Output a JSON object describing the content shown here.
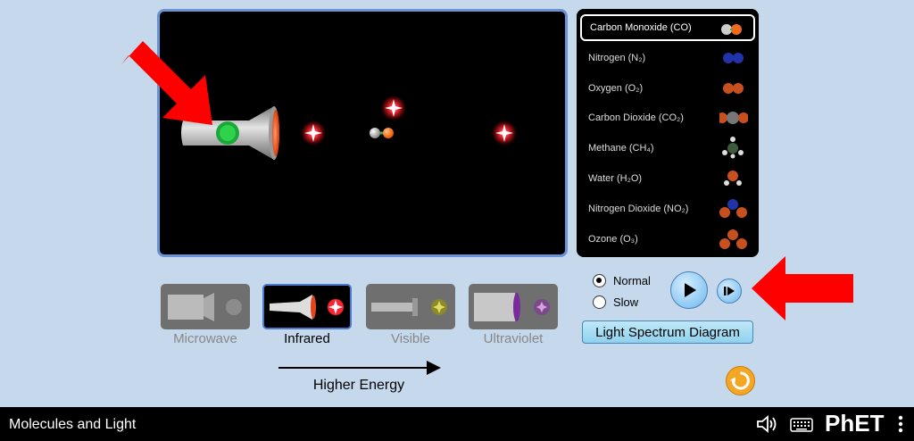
{
  "molecules": [
    {
      "name": "Carbon Monoxide (CO)",
      "selected": true
    },
    {
      "name": "Nitrogen (N₂)",
      "selected": false
    },
    {
      "name": "Oxygen (O₂)",
      "selected": false
    },
    {
      "name": "Carbon Dioxide (CO₂)",
      "selected": false
    },
    {
      "name": "Methane (CH₄)",
      "selected": false
    },
    {
      "name": "Water (H₂O)",
      "selected": false
    },
    {
      "name": "Nitrogen Dioxide (NO₂)",
      "selected": false
    },
    {
      "name": "Ozone (O₃)",
      "selected": false
    }
  ],
  "light_sources": [
    {
      "label": "Microwave",
      "selected": false
    },
    {
      "label": "Infrared",
      "selected": true
    },
    {
      "label": "Visible",
      "selected": false
    },
    {
      "label": "Ultraviolet",
      "selected": false
    }
  ],
  "energy_label": "Higher Energy",
  "speed": {
    "normal": "Normal",
    "slow": "Slow",
    "selected": "normal"
  },
  "spectrum_button": "Light Spectrum Diagram",
  "nav": {
    "title": "Molecules and Light",
    "logo": "PhET"
  },
  "colors": {
    "accent_border": "#4a7bd0",
    "arrow": "#ff0000",
    "panel_bg": "#000000",
    "page_bg": "#c5d8ec"
  },
  "icons": [
    "play-icon",
    "step-icon",
    "reset-icon",
    "sound-icon",
    "keyboard-icon",
    "menu-dots-icon"
  ]
}
